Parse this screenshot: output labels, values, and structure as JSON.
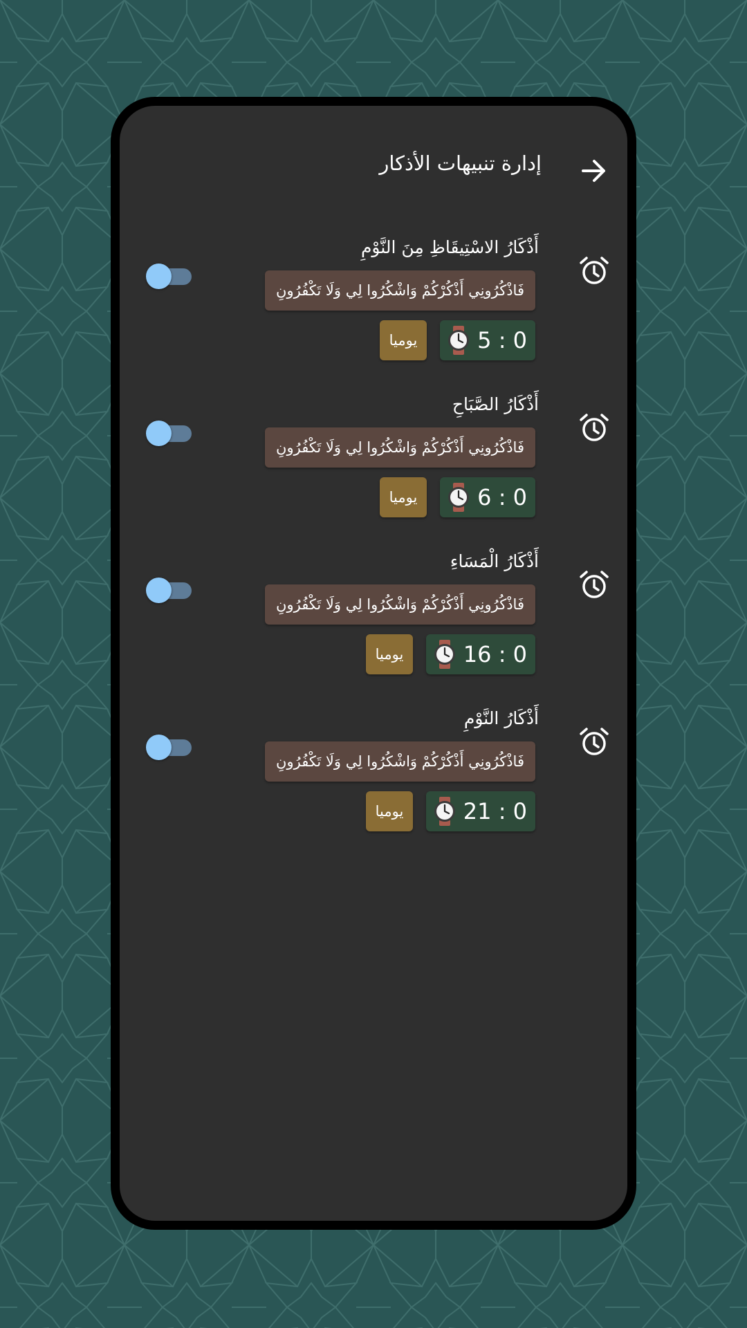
{
  "colors": {
    "background": "#2a5655",
    "panel": "#2f2f2f",
    "verse_chip": "#5b4740",
    "time_chip": "#2e4b3a",
    "repeat_chip": "#8a6d35",
    "toggle_thumb": "#90caf9",
    "toggle_track": "#5e7c98"
  },
  "header": {
    "title": "إدارة تنبيهات الأذكار",
    "back_icon": "arrow-right-icon"
  },
  "alarms": [
    {
      "icon": "alarm-clock-icon",
      "title": "أَذْكَارُ الاسْتِيقَاظِ مِنَ النَّوْمِ",
      "verse": "فَاذْكُرُونِي أَذْكُرْكُمْ وَاشْكُرُوا لِي وَلَا تَكْفُرُونِ",
      "time": "5 : 0",
      "repeat": "يوميا",
      "enabled": false
    },
    {
      "icon": "alarm-clock-icon",
      "title": "أَذْكَارُ الصَّبَاحِ",
      "verse": "فَاذْكُرُونِي أَذْكُرْكُمْ وَاشْكُرُوا لِي وَلَا تَكْفُرُونِ",
      "time": "6 : 0",
      "repeat": "يوميا",
      "enabled": false
    },
    {
      "icon": "alarm-clock-icon",
      "title": "أَذْكَارُ الْمَسَاءِ",
      "verse": "فَاذْكُرُونِي أَذْكُرْكُمْ وَاشْكُرُوا لِي وَلَا تَكْفُرُونِ",
      "time": "16 : 0",
      "repeat": "يوميا",
      "enabled": false
    },
    {
      "icon": "alarm-clock-icon",
      "title": "أَذْكَارُ النَّوْمِ",
      "verse": "فَاذْكُرُونِي أَذْكُرْكُمْ وَاشْكُرُوا لِي وَلَا تَكْفُرُونِ",
      "time": "21 : 0",
      "repeat": "يوميا",
      "enabled": false
    }
  ]
}
